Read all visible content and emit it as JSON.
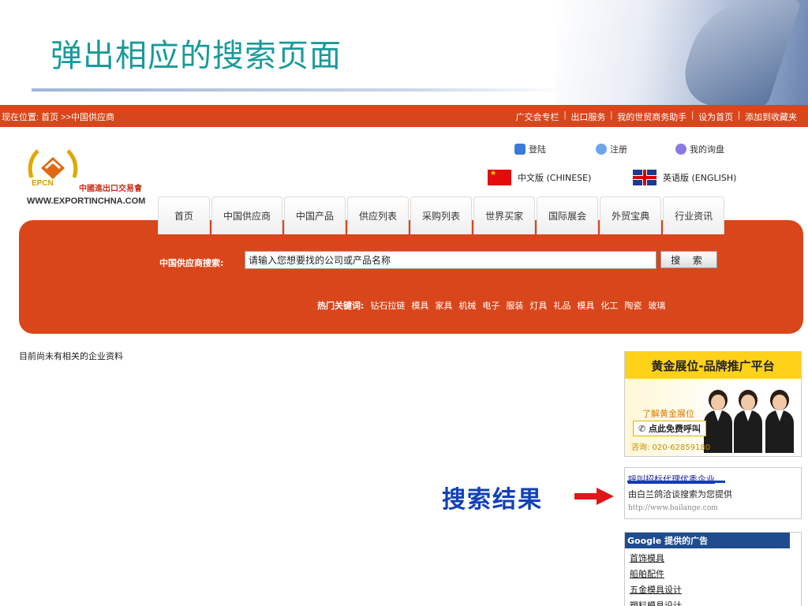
{
  "slide": {
    "title": "弹出相应的搜索页面",
    "annotation": "搜索结果"
  },
  "topbar": {
    "breadcrumb": "现在位置: 首页 >>中国供应商",
    "links": [
      "广交会专栏",
      "出口服务",
      "我的世贸商务助手",
      "设为首页",
      "添加到收藏夹"
    ]
  },
  "logo": {
    "abbr": "EPCN",
    "cn_name": "中國進出口交易會",
    "url": "WWW.EXPORTINCHNA.COM"
  },
  "user_links": {
    "login": "登陆",
    "register": "注册",
    "inquiry": "我的询盘"
  },
  "languages": {
    "chinese": "中文版 (CHINESE)",
    "english": "英语版 (ENGLISH)"
  },
  "nav": {
    "tabs": [
      "首页",
      "中国供应商",
      "中国产品",
      "供应列表",
      "采购列表",
      "世界买家",
      "国际展会",
      "外贸宝典",
      "行业资讯"
    ]
  },
  "search": {
    "label": "中国供应商搜索:",
    "value": "请输入您想要找的公司或产品名称",
    "button": "搜 索"
  },
  "hot_keywords": {
    "label": "热门关键词:",
    "items": [
      "钻石拉链",
      "模具",
      "家具",
      "机械",
      "电子",
      "服装",
      "灯具",
      "礼品",
      "模具",
      "化工",
      "陶瓷",
      "玻璃"
    ]
  },
  "main": {
    "no_result": "目前尚未有相关的企业资料"
  },
  "ad": {
    "title": "黄金展位-品牌推广平台",
    "learn_more": "了解黄金展位",
    "call_button": "点此免费呼叫",
    "phone": "咨询: 020-62859180"
  },
  "result": {
    "link": "呼叫招标代理优秀企业",
    "desc": "由白兰鸽洽谈搜索为您提供",
    "url": "http://www.bailange.com"
  },
  "google_ads": {
    "header": "Google 提供的广告",
    "items": [
      "首饰模具",
      "船舶配件",
      "五金模具设计",
      "塑料模具设计"
    ]
  },
  "colors": {
    "brand_orange": "#d9461b",
    "title_teal": "#1a9a9a",
    "annotation_blue": "#1240b8",
    "arrow_red": "#e0161b"
  }
}
